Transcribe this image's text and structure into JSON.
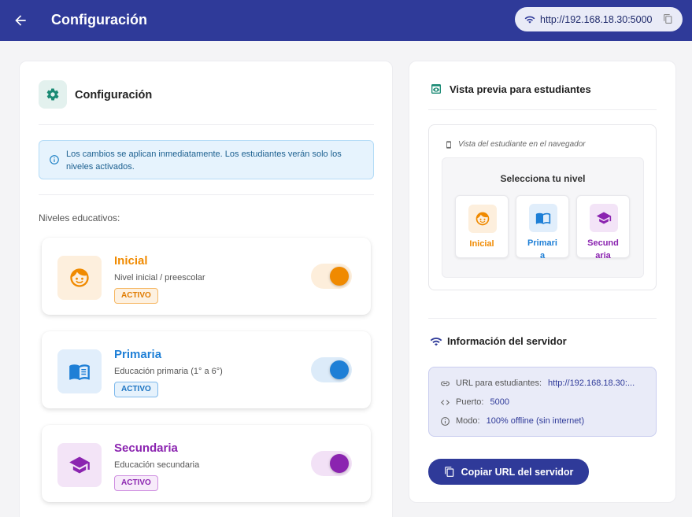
{
  "appbar": {
    "title": "Configuración",
    "server_url": "http://192.168.18.30:5000",
    "back_icon": "arrow-left-icon",
    "wifi_icon": "wifi-icon",
    "copy_icon": "copy-icon"
  },
  "settings": {
    "title": "Configuración",
    "icon": "gear-icon",
    "info": "Los cambios se aplican inmediatamente. Los estudiantes verán solo los niveles activados.",
    "section_label": "Niveles educativos:",
    "levels": [
      {
        "name": "Inicial",
        "description": "Nivel inicial / preescolar",
        "badge": "ACTIVO",
        "active": true,
        "color": "#f08a00",
        "icon": "child-face-icon"
      },
      {
        "name": "Primaria",
        "description": "Educación primaria (1° a 6°)",
        "badge": "ACTIVO",
        "active": true,
        "color": "#1e7fd6",
        "icon": "open-book-icon"
      },
      {
        "name": "Secundaria",
        "description": "Educación secundaria",
        "badge": "ACTIVO",
        "active": true,
        "color": "#8b24b0",
        "icon": "graduation-cap-icon"
      }
    ]
  },
  "preview": {
    "title": "Vista previa para estudiantes",
    "caption": "Vista del estudiante en el navegador",
    "choose_label": "Selecciona tu nivel",
    "cards": [
      {
        "line1": "Inicial",
        "line2": ""
      },
      {
        "line1": "Primari",
        "line2": "a"
      },
      {
        "line1": "Secund",
        "line2": "aria"
      }
    ]
  },
  "server": {
    "title": "Información del servidor",
    "url_label": "URL para estudiantes:",
    "url_value": "http://192.168.18.30:...",
    "port_label": "Puerto:",
    "port_value": "5000",
    "mode_label": "Modo:",
    "mode_value": "100% offline (sin internet)",
    "copy_button": "Copiar URL del servidor"
  },
  "colors": {
    "primary": "#2f3a99",
    "teal": "#1a8a74",
    "orange": "#f08a00",
    "blue": "#1e7fd6",
    "purple": "#8b24b0"
  }
}
